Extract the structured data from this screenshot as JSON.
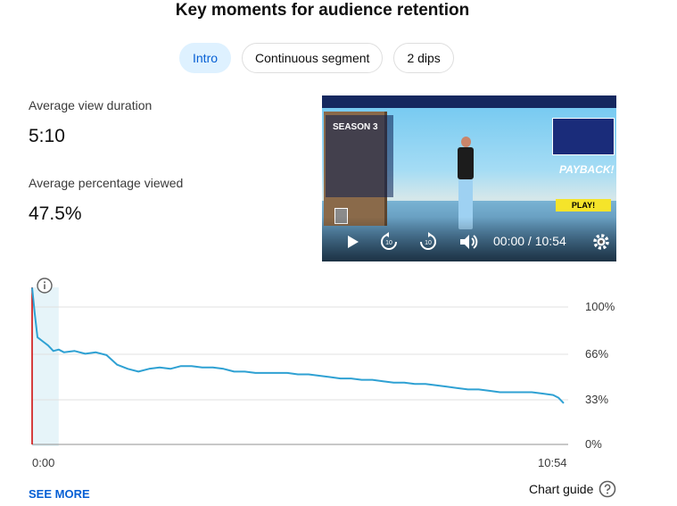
{
  "title": "Key moments for audience retention",
  "tabs": [
    {
      "label": "Intro",
      "selected": true
    },
    {
      "label": "Continuous segment",
      "selected": false
    },
    {
      "label": "2 dips",
      "selected": false
    }
  ],
  "metrics": {
    "avg_view_duration_label": "Average view duration",
    "avg_view_duration_value": "5:10",
    "avg_pct_viewed_label": "Average percentage viewed",
    "avg_pct_viewed_value": "47.5%"
  },
  "video": {
    "timecode": "00:00 / 10:54",
    "game_season": "SEASON 3",
    "game_banner": "PAYBACK!",
    "game_cta": "PLAY!",
    "icons": [
      "play-icon",
      "replay-10-icon",
      "forward-10-icon",
      "volume-icon",
      "settings-gear-icon"
    ]
  },
  "chart_data": {
    "type": "line",
    "y_ticks": [
      "100%",
      "66%",
      "33%",
      "0%"
    ],
    "x_ticks": [
      "0:00",
      "10:54"
    ],
    "ylim": [
      0,
      100
    ],
    "highlight_range_fraction": [
      0,
      0.05
    ],
    "x": [
      0.0,
      0.005,
      0.01,
      0.02,
      0.03,
      0.04,
      0.05,
      0.06,
      0.08,
      0.1,
      0.12,
      0.14,
      0.16,
      0.18,
      0.2,
      0.22,
      0.24,
      0.26,
      0.28,
      0.3,
      0.32,
      0.34,
      0.36,
      0.38,
      0.4,
      0.42,
      0.44,
      0.46,
      0.48,
      0.5,
      0.52,
      0.54,
      0.56,
      0.58,
      0.6,
      0.62,
      0.64,
      0.66,
      0.68,
      0.7,
      0.72,
      0.74,
      0.76,
      0.78,
      0.8,
      0.82,
      0.84,
      0.86,
      0.88,
      0.9,
      0.92,
      0.94,
      0.96,
      0.98,
      0.99,
      1.0
    ],
    "y": [
      114,
      95,
      78,
      75,
      72,
      68,
      69,
      67,
      68,
      66,
      67,
      65,
      58,
      55,
      53,
      55,
      56,
      55,
      57,
      57,
      56,
      56,
      55,
      53,
      53,
      52,
      52,
      52,
      52,
      51,
      51,
      50,
      49,
      48,
      48,
      47,
      47,
      46,
      45,
      45,
      44,
      44,
      43,
      42,
      41,
      40,
      40,
      39,
      38,
      38,
      38,
      38,
      37,
      36,
      34,
      30
    ],
    "accent_color": "#2fa1d3",
    "highlight_color": "#e6f4f9",
    "start_marker_color": "#cc0000"
  },
  "footer": {
    "see_more": "SEE MORE",
    "chart_guide": "Chart guide"
  }
}
